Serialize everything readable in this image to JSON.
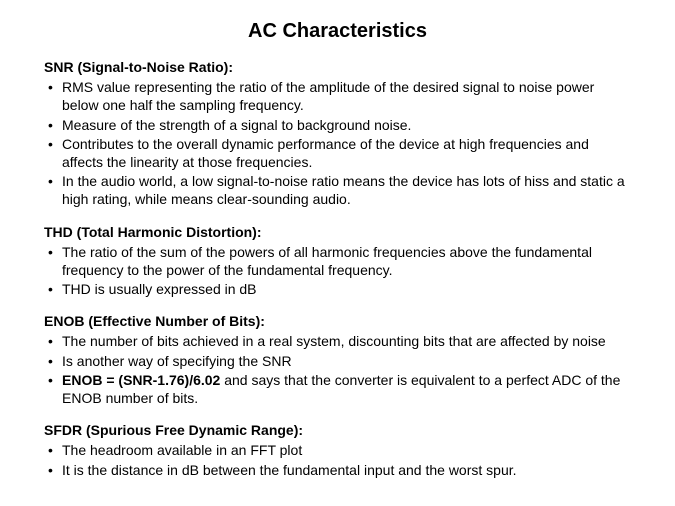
{
  "title": "AC Characteristics",
  "sections": [
    {
      "heading": "SNR (Signal-to-Noise Ratio):",
      "items": [
        {
          "text": "RMS value representing the ratio of the amplitude of the desired signal to noise power below one half the sampling frequency."
        },
        {
          "text": "Measure of the strength of a signal to background noise."
        },
        {
          "text": "Contributes to the overall dynamic performance of the device at high frequencies and affects the linearity at those frequencies."
        },
        {
          "text": "In the audio world, a low signal-to-noise ratio means the device has lots of hiss and static a high rating, while means clear-sounding audio."
        }
      ]
    },
    {
      "heading": "THD (Total Harmonic Distortion):",
      "items": [
        {
          "text": "The ratio of the sum of the powers of all harmonic frequencies above the fundamental frequency to the power of the fundamental frequency."
        },
        {
          "text": "THD is usually expressed in dB"
        }
      ]
    },
    {
      "heading": "ENOB (Effective Number of Bits):",
      "items": [
        {
          "text": "The number of bits achieved in a real system, discounting bits that are affected by noise"
        },
        {
          "text": "Is another way of specifying the SNR"
        },
        {
          "boldPrefix": "ENOB = (SNR-1.76)/6.02 ",
          "text": "and says that the converter is equivalent to a perfect ADC of the ENOB number of bits."
        }
      ]
    },
    {
      "heading": "SFDR (Spurious Free Dynamic Range):",
      "items": [
        {
          "text": "The headroom available in an FFT plot"
        },
        {
          "text": "It is the distance in dB between the fundamental input and the worst spur."
        }
      ]
    }
  ]
}
